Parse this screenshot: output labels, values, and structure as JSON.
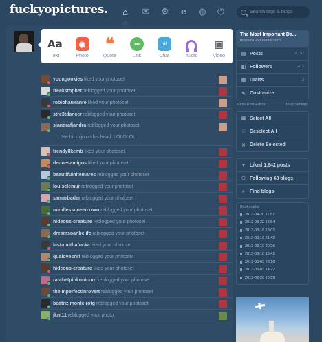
{
  "header": {
    "logo": "fuckyopictures.",
    "search_placeholder": "Search tags & blogs",
    "nav": [
      "home-icon",
      "mail-icon",
      "gear-icon",
      "explore-icon",
      "activity-icon",
      "power-icon"
    ]
  },
  "post_types": [
    {
      "label": "Text",
      "glyph": "Aa",
      "icon": "text-icon"
    },
    {
      "label": "Photo",
      "glyph": "◉",
      "icon": "camera-icon"
    },
    {
      "label": "Quote",
      "glyph": "❝",
      "icon": "quote-icon"
    },
    {
      "label": "Link",
      "glyph": "∞",
      "icon": "link-icon"
    },
    {
      "label": "Chat",
      "glyph": "hi!",
      "icon": "chat-icon"
    },
    {
      "label": "Audio",
      "glyph": "",
      "icon": "headphones-icon"
    },
    {
      "label": "Video",
      "glyph": "▣",
      "icon": "video-camera-icon"
    }
  ],
  "notes": [
    {
      "user": "youngookies",
      "action": "liked your photoset"
    },
    {
      "user": "freekstopher",
      "action": "reblogged your photoset"
    },
    {
      "user": "robiohauxanre",
      "action": "liked your photoset"
    },
    {
      "user": "stre3tdancer",
      "action": "reblogged your photoset"
    },
    {
      "user": "sjandrafjandra",
      "action": "reblogged your photoset",
      "reply": "He hit mijo on his head. LOLOLOL"
    },
    {
      "user": "trendyllkemb",
      "action": "liked your photoset"
    },
    {
      "user": "deuoesamigos",
      "action": "liked your photoset"
    },
    {
      "user": "beautifulnitemares",
      "action": "reblogged your photoset"
    },
    {
      "user": "louiselemur",
      "action": "reblogged your photoset"
    },
    {
      "user": "samarbader",
      "action": "reblogged your photoset"
    },
    {
      "user": "mindlessqueenxoxo",
      "action": "reblogged your photoset"
    },
    {
      "user": "hideous-creature",
      "action": "reblogged your photoset"
    },
    {
      "user": "dreamsoanbelife",
      "action": "reblogged your photoset"
    },
    {
      "user": "last-muthafucka",
      "action": "liked your photoset"
    },
    {
      "user": "qualovesrirl",
      "action": "reblogged your photoset"
    },
    {
      "user": "hideous-creature",
      "action": "liked your photoset"
    },
    {
      "user": "ratchetpinkunicorn",
      "action": "reblogged your photoset"
    },
    {
      "user": "theimperfectinrovert",
      "action": "reblogged your photoset"
    },
    {
      "user": "beatrizjmontelrotg",
      "action": "reblogged your photoset"
    },
    {
      "user": "jknt11",
      "action": "reblogged your photo"
    }
  ],
  "sidebar": {
    "blog_title": "The Most Important Da...",
    "blog_url": "mayb/n1955.tumblr.com",
    "items": [
      {
        "label": "Posts",
        "count": "2,737",
        "icon": "posts-icon"
      },
      {
        "label": "Followers",
        "count": "412",
        "icon": "followers-icon"
      },
      {
        "label": "Drafts",
        "count": "73",
        "icon": "drafts-icon"
      },
      {
        "label": "Customize",
        "count": "",
        "icon": "customize-icon"
      }
    ],
    "mass_post_editor": "Mass Post Editor",
    "blog_settings": "Blog Settings",
    "actions": [
      {
        "label": "Select All",
        "icon": "checkbox-icon"
      },
      {
        "label": "Deselect All",
        "icon": "checkbox-icon"
      },
      {
        "label": "Delete Selected",
        "icon": "x-icon"
      }
    ],
    "social": [
      {
        "label": "Liked 1,642 posts",
        "icon": "heart-icon"
      },
      {
        "label": "Following 68 blogs",
        "icon": "following-icon"
      },
      {
        "label": "Find blogs",
        "icon": "find-icon"
      }
    ],
    "bookmarks_label": "Bookmarks",
    "bookmarks": [
      "2013-04-20 11:57",
      "2013-03-22 12:54",
      "2013-03-18 18:01",
      "2013-03-16 21:45",
      "2013-03-10 20:26",
      "2013-03-10 15:41",
      "2013-03-03 23:16",
      "2013-03-03 14:27",
      "2013-02-28 20:59"
    ]
  },
  "colors": {
    "background": "#2c4762",
    "panel": "#2f4b66",
    "sidebar_card": "#3b5876"
  }
}
